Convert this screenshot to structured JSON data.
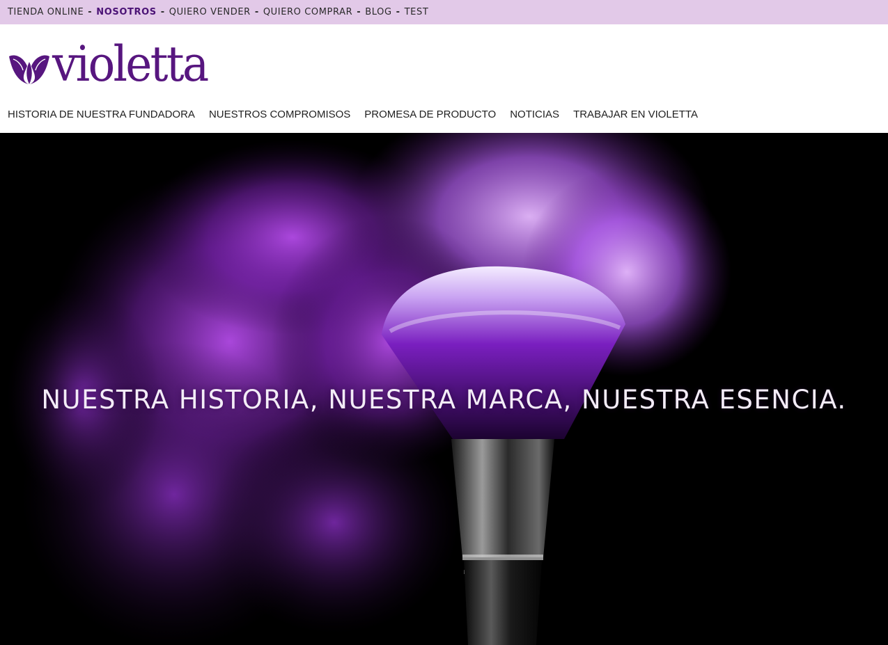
{
  "topbar": {
    "items": [
      {
        "label": "TIENDA ONLINE",
        "active": false
      },
      {
        "label": "NOSOTROS",
        "active": true
      },
      {
        "label": "QUIERO VENDER",
        "active": false
      },
      {
        "label": "QUIERO COMPRAR",
        "active": false
      },
      {
        "label": "BLOG",
        "active": false
      },
      {
        "label": "TEST",
        "active": false
      }
    ],
    "separator": "-",
    "background": "#e2c9e8",
    "active_color": "#4b1376"
  },
  "logo": {
    "text": "violetta",
    "icon": "violet-flower-logo-icon",
    "color": "#57167f"
  },
  "mainnav": {
    "items": [
      {
        "label": "HISTORIA DE NUESTRA FUNDADORA"
      },
      {
        "label": "NUESTROS COMPROMISOS"
      },
      {
        "label": "PROMESA DE PRODUCTO"
      },
      {
        "label": "NOTICIAS"
      },
      {
        "label": "TRABAJAR EN VIOLETTA"
      }
    ]
  },
  "hero": {
    "title": "NUESTRA HISTORIA, NUESTRA MARCA, NUESTRA ESENCIA.",
    "image": "makeup-brush-purple-powder-image",
    "accent": "#a23be0"
  }
}
